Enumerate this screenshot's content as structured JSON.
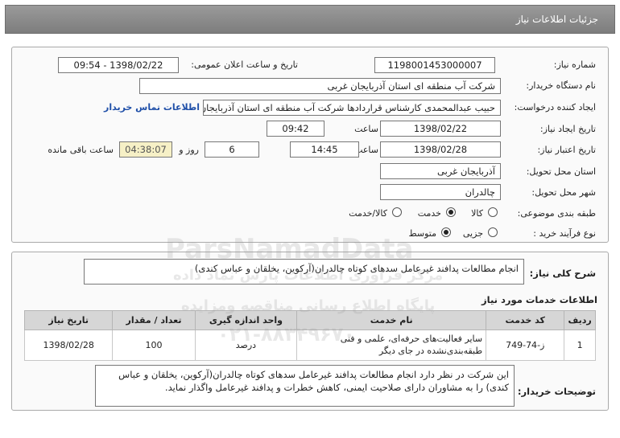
{
  "header": {
    "title": "جزئیات اطلاعات نیاز"
  },
  "form": {
    "need_number_label": "شماره نیاز:",
    "need_number": "1198001453000007",
    "announce_label": "تاریخ و ساعت اعلان عمومی:",
    "announce_value": "1398/02/22 - 09:54",
    "buyer_org_label": "نام دستگاه خریدار:",
    "buyer_org": "شرکت آب منطقه ای استان آذربایجان غربی",
    "requester_label": "ایجاد کننده درخواست:",
    "requester": "حبیب عبدالمحمدی کارشناس قراردادها شرکت آب منطقه ای استان آذربایجان غ",
    "contact_link": "اطلاعات تماس خریدار",
    "created_date_label": "تاریخ ایجاد نیاز:",
    "created_date": "1398/02/22",
    "time_label": "ساعت",
    "created_time": "09:42",
    "validity_label": "تاریخ اعتبار نیاز:",
    "validity_date": "1398/02/28",
    "validity_time": "14:45",
    "days": "6",
    "days_label": "روز و",
    "remaining": "04:38:07",
    "remaining_label": "ساعت باقی مانده",
    "province_label": "استان محل تحویل:",
    "province": "آذربایجان غربی",
    "city_label": "شهر محل تحویل:",
    "city": "چالدران",
    "category_label": "طبقه بندی موضوعی:",
    "category_options": [
      "کالا",
      "خدمت",
      "کالا/خدمت"
    ],
    "process_label": "نوع فرآیند خرید :",
    "process_options": [
      "جزیی",
      "متوسط"
    ]
  },
  "summary": {
    "label": "شرح کلی نیاز:",
    "text": "انجام مطالعات پدافند غیرعامل سدهای کوتاه چالدران(آرکوین، یخلقان و عباس کندی)"
  },
  "services": {
    "title": "اطلاعات خدمات مورد نیاز",
    "headers": [
      "ردیف",
      "کد خدمت",
      "نام خدمت",
      "واحد اندازه گیری",
      "تعداد / مقدار",
      "تاریخ نیاز"
    ],
    "rows": [
      [
        "1",
        "ز-74-749",
        "سایر فعالیت‌های حرفه‌ای، علمی و فنی طبقه‌بندی‌نشده در جای دیگر",
        "درصد",
        "100",
        "1398/02/28"
      ]
    ]
  },
  "buyer_desc": {
    "label": "توضیحات خریدار:",
    "text": "این شرکت در نظر دارد انجام مطالعات پدافند غیرعامل سدهای کوتاه چالدران(آرکوین، یخلقان و عباس کندی) را به مشاوران دارای صلاحیت ایمنی، کاهش خطرات و پدافند غیرعامل واگذار نماید."
  },
  "watermark": {
    "brand": "ParsNamadData",
    "line1": "مرکز فراوری اطلاعات پارس نماد داده",
    "line2": "پایگاه اطلاع رسانی مناقصه ومزایده",
    "phone": "۰۲۱-۸۸۳۴۹۶۷۰"
  }
}
